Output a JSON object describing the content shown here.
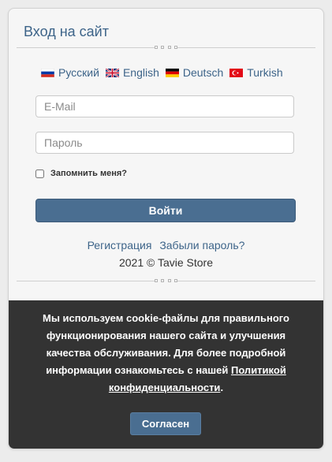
{
  "login": {
    "title": "Вход на сайт",
    "languages": [
      {
        "label": "Русский",
        "flag": "ru-flag-icon"
      },
      {
        "label": "English",
        "flag": "uk-flag-icon"
      },
      {
        "label": "Deutsch",
        "flag": "de-flag-icon"
      },
      {
        "label": "Turkish",
        "flag": "tr-flag-icon"
      }
    ],
    "email_placeholder": "E-Mail",
    "password_placeholder": "Пароль",
    "remember_label": "Запомнить меня?",
    "login_button": "Войти",
    "register_link": "Регистрация",
    "forgot_link": "Забыли пароль?",
    "copyright": "2021 © Tavie Store"
  },
  "cookie": {
    "text": "Мы используем cookie-файлы для правильного функционирования нашего сайта и улучшения качества обслуживания. Для более подробной информации ознакомьтесь с нашей",
    "policy_link": "Политикой конфиденциальности",
    "suffix": ".",
    "agree_button": "Согласен"
  },
  "colors": {
    "accent": "#4a6e91",
    "link": "#3d6489",
    "cookie_bg": "#333333"
  }
}
